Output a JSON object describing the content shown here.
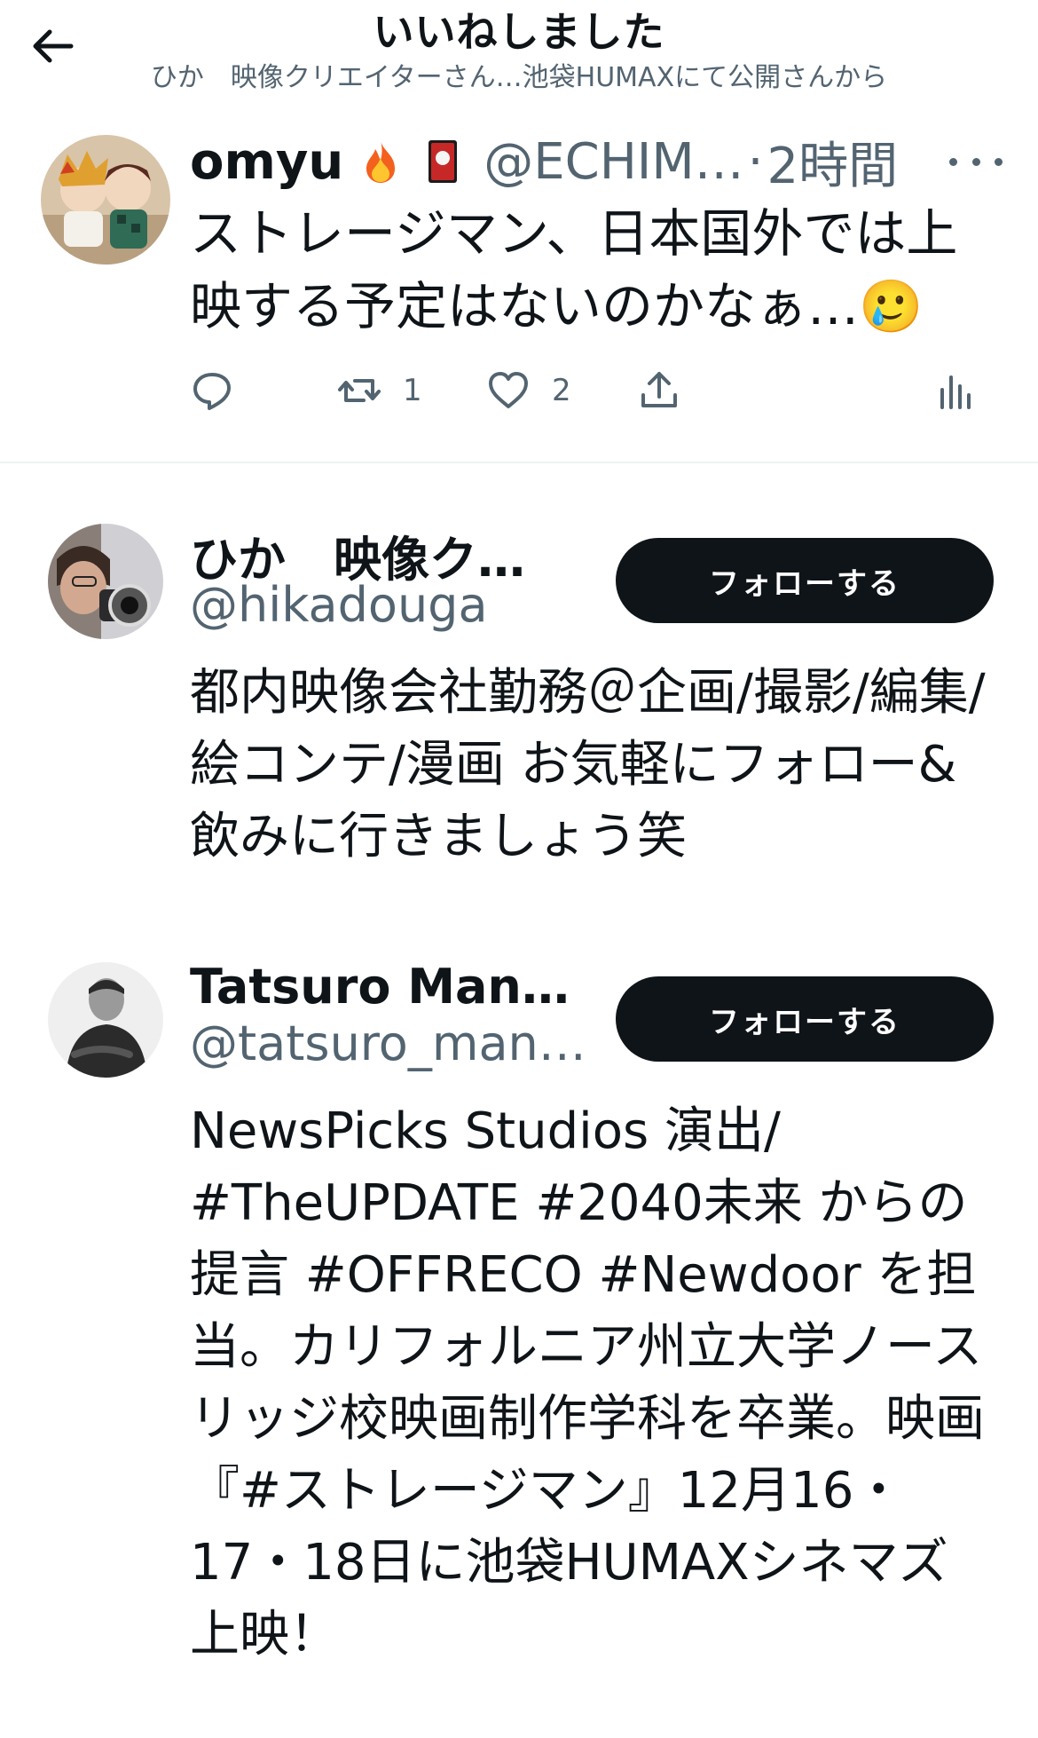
{
  "header": {
    "title": "いいねしました",
    "subtitle": "ひか　映像クリエイターさん…池袋HUMAXにて公開さんから"
  },
  "tweet": {
    "name": "omyu",
    "emojis": [
      "fire-emoji",
      "hanafuda-emoji"
    ],
    "handle": "@ECHIM…",
    "separator": "·",
    "time": "2時間",
    "text": "ストレージマン、日本国外では上映する予定はないのかなぁ…🥲",
    "actions": {
      "reply_count": "",
      "retweet_count": "1",
      "like_count": "2"
    },
    "icons": [
      "reply-icon",
      "retweet-icon",
      "like-icon",
      "share-icon",
      "analytics-icon"
    ]
  },
  "users": [
    {
      "name": "ひか　映像ク…",
      "handle": "@hikadouga",
      "follow_label": "フォローする",
      "bio": "都内映像会社勤務＠企画/撮影/編集/絵コンテ/漫画 お気軽にフォロー&飲みに行きましょう笑"
    },
    {
      "name": "Tatsuro Mann…",
      "handle": "@tatsuro_man…",
      "follow_label": "フォローする",
      "bio": "NewsPicks Studios 演出/ #TheUPDATE #2040未来 からの提言 #OFFRECO #Newdoor を担当。カリフォルニア州立大学ノースリッジ校映画制作学科を卒業。映画『#ストレージマン』12月16・17・18日に池袋HUMAXシネマズ上映！"
    }
  ],
  "colors": {
    "text": "#0f1419",
    "secondary": "#536471",
    "button_bg": "#0f1419",
    "button_text": "#ffffff",
    "divider": "#eff3f4"
  }
}
